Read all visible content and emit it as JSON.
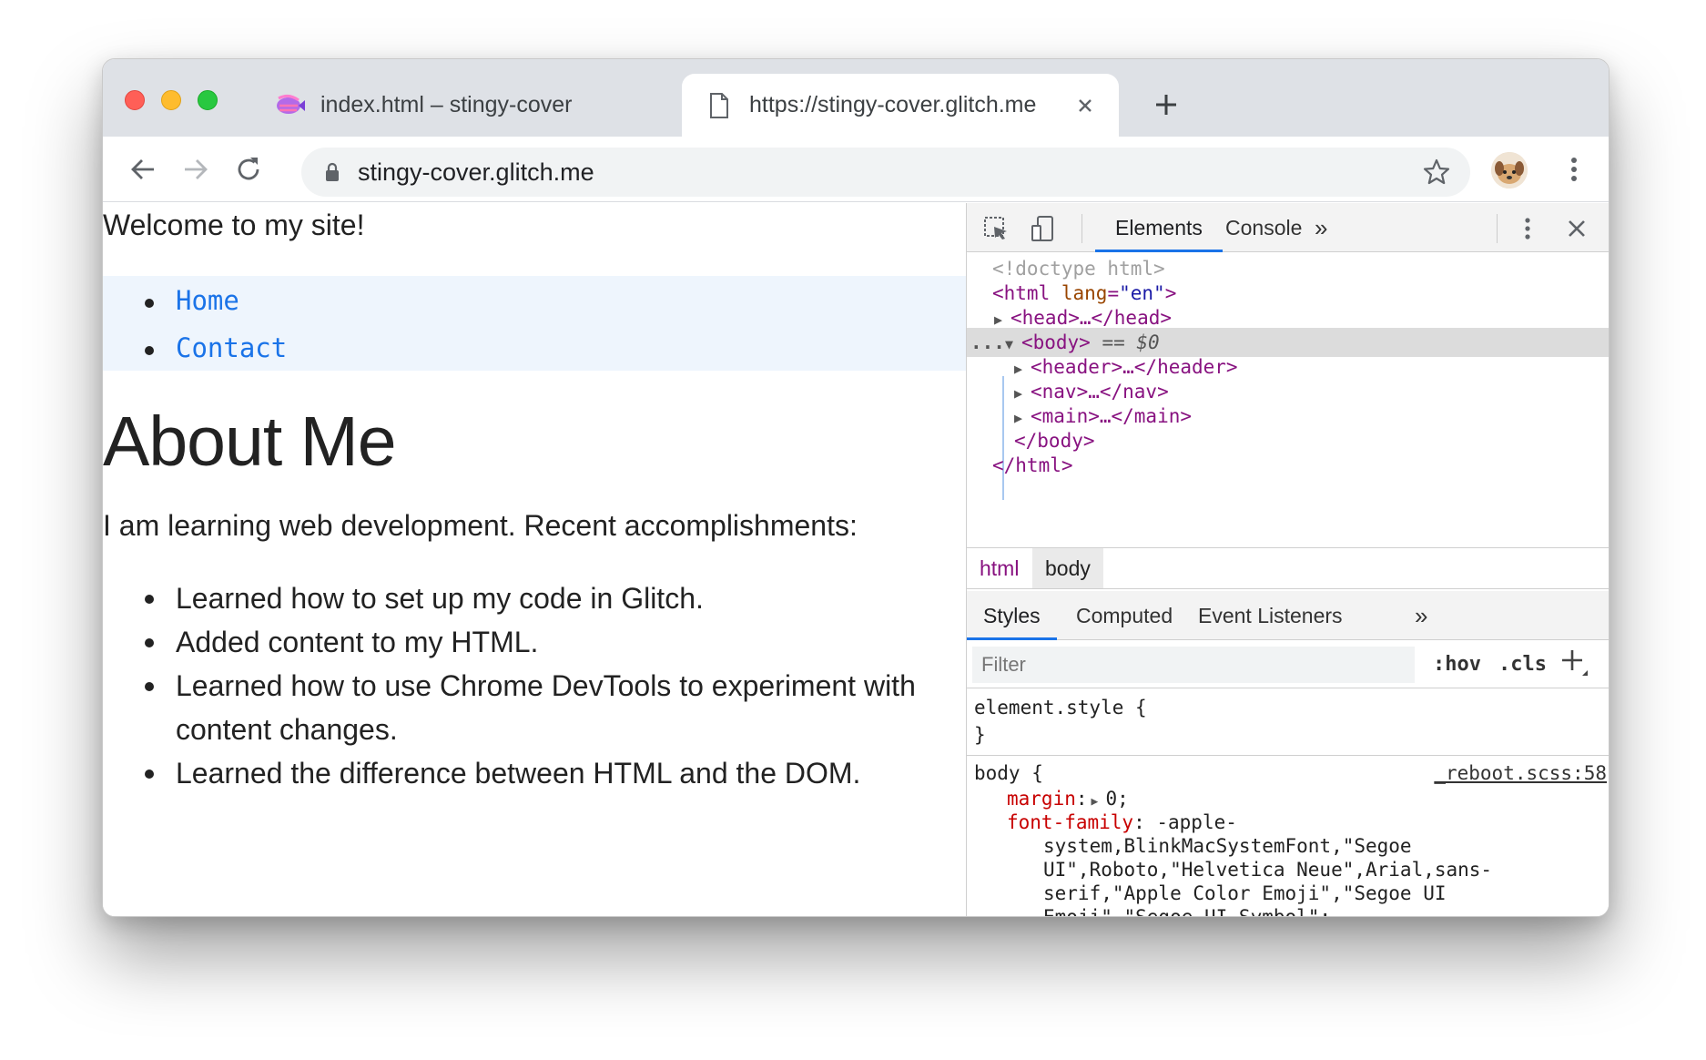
{
  "browser": {
    "tabs": [
      {
        "title": "index.html – stingy-cover",
        "icon": "glitch-fish-icon"
      },
      {
        "title": "https://stingy-cover.glitch.me",
        "icon": "document-icon"
      }
    ],
    "url": "stingy-cover.glitch.me",
    "colors": {
      "close": "#ff5f57",
      "minimize": "#febc2e",
      "zoom": "#28c840",
      "accent": "#1a73e8"
    }
  },
  "page": {
    "welcome": "Welcome to my site!",
    "nav": [
      "Home",
      "Contact"
    ],
    "heading": "About Me",
    "intro": "I am learning web development. Recent accomplishments:",
    "items": [
      "Learned how to set up my code in Glitch.",
      "Added content to my HTML.",
      "Learned how to use Chrome DevTools to experiment with content changes.",
      "Learned the difference between HTML and the DOM."
    ]
  },
  "devtools": {
    "tabs": [
      "Elements",
      "Console"
    ],
    "more": "»",
    "dom": {
      "doctype": "<!doctype html>",
      "html_open": "<html",
      "lang_attr": "lang",
      "lang_val": "\"en\"",
      "head": "<head>…</head>",
      "body_open": "<body>",
      "body_marker": "== $0",
      "ellipsis": "...",
      "header": "<header>…</header>",
      "nav": "<nav>…</nav>",
      "main": "<main>…</main>",
      "body_close": "</body>",
      "html_close": "</html>"
    },
    "breadcrumbs": [
      "html",
      "body"
    ],
    "sub_tabs": [
      "Styles",
      "Computed",
      "Event Listeners"
    ],
    "filter_placeholder": "Filter",
    "hov": ":hov",
    "cls": ".cls",
    "styles": {
      "element_style": "element.style {",
      "close_brace": "}",
      "body_selector": "body {",
      "source": "_reboot.scss:58",
      "margin_prop": "margin",
      "margin_val": "0;",
      "font_prop": "font-family",
      "font_val_1": "-apple-",
      "font_val_2": "system,BlinkMacSystemFont,\"Segoe",
      "font_val_3": "UI\",Roboto,\"Helvetica Neue\",Arial,sans-",
      "font_val_4": "serif,\"Apple Color Emoji\",\"Segoe UI",
      "font_val_5": "Emoji\",\"Segoe UI Symbol\";"
    }
  }
}
